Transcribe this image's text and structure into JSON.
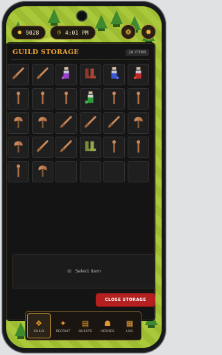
{
  "topbar": {
    "gold_amount": "9028",
    "gold_icon": "coin-stack-icon",
    "time": "4:01 PM",
    "clock_icon": "clock-icon",
    "resources_icon": "resources-icon",
    "settings_icon": "gear-icon"
  },
  "storage": {
    "title": "GUILD STORAGE",
    "item_count": "26 ITEMS",
    "items": [
      "sword",
      "sword",
      "potion-purple",
      "boots",
      "potion-blue",
      "potion-red",
      "torch",
      "torch",
      "torch",
      "potion-green",
      "torch",
      "torch",
      "axe",
      "axe",
      "sword",
      "sword",
      "sword",
      "axe",
      "axe",
      "sword",
      "sword",
      "boots-green",
      "torch",
      "torch",
      "torch",
      "axe"
    ],
    "empty_slots": 4
  },
  "detail": {
    "placeholder": "Select Item"
  },
  "actions": {
    "close_label": "CLOSE STORAGE"
  },
  "nav": {
    "items": [
      {
        "label": "GUILD",
        "icon": "guild-icon"
      },
      {
        "label": "RECRUIT",
        "icon": "recruit-icon"
      },
      {
        "label": "QUESTS",
        "icon": "scroll-icon"
      },
      {
        "label": "HEROES",
        "icon": "heroes-icon"
      },
      {
        "label": "LOG",
        "icon": "log-icon"
      }
    ]
  },
  "colors": {
    "accent": "#f0a632",
    "close_button": "#b3201f",
    "panel": "#141414"
  }
}
